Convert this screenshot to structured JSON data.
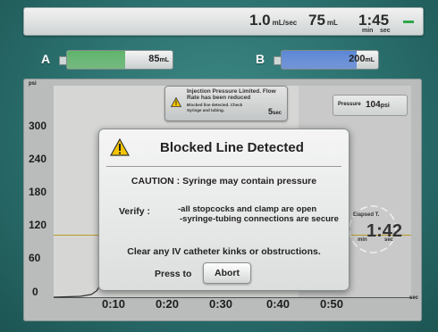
{
  "status_bar": {
    "flow_rate": "1.0",
    "flow_unit": "mL/sec",
    "volume": "75",
    "volume_unit": "mL",
    "time": "1:45",
    "time_min_label": "min",
    "time_sec_label": "sec",
    "indicator_color": "#2fa84a"
  },
  "syringes": [
    {
      "label": "A",
      "value": "85",
      "unit": "mL",
      "color": "#5fb36b",
      "fill_fraction": 0.55
    },
    {
      "label": "B",
      "value": "200",
      "unit": "mL",
      "color": "#5b86d6",
      "fill_fraction": 0.78
    }
  ],
  "graph": {
    "y_unit": "psi",
    "x_unit": "sec",
    "y_ticks": [
      "300",
      "240",
      "180",
      "120",
      "60",
      "0"
    ],
    "x_ticks": [
      "0:10",
      "0:20",
      "0:30",
      "0:40",
      "0:50"
    ],
    "threshold_color": "#b99b2a"
  },
  "notice": {
    "title": "Injection Pressure Limited. Flow Rate has been reduced",
    "body": "Blocked line detected. Check Syringe and tubing.",
    "countdown": "5",
    "countdown_unit": "sec"
  },
  "pressure": {
    "label": "Pressure",
    "value": "104",
    "unit": "psi"
  },
  "elapsed": {
    "label": "Elapsed T.",
    "value": "1:42",
    "min_label": "min",
    "sec_label": "sec"
  },
  "dialog": {
    "title": "Blocked Line Detected",
    "caution": "CAUTION : Syringe may contain pressure",
    "verify_label": "Verify :",
    "verify_line1": "-all stopcocks and clamp are open",
    "verify_line2": "-syringe-tubing connections are secure",
    "clear_text": "Clear any IV catheter kinks or obstructions.",
    "press_to": "Press to",
    "abort_label": "Abort",
    "warning_color": "#f5c400"
  }
}
